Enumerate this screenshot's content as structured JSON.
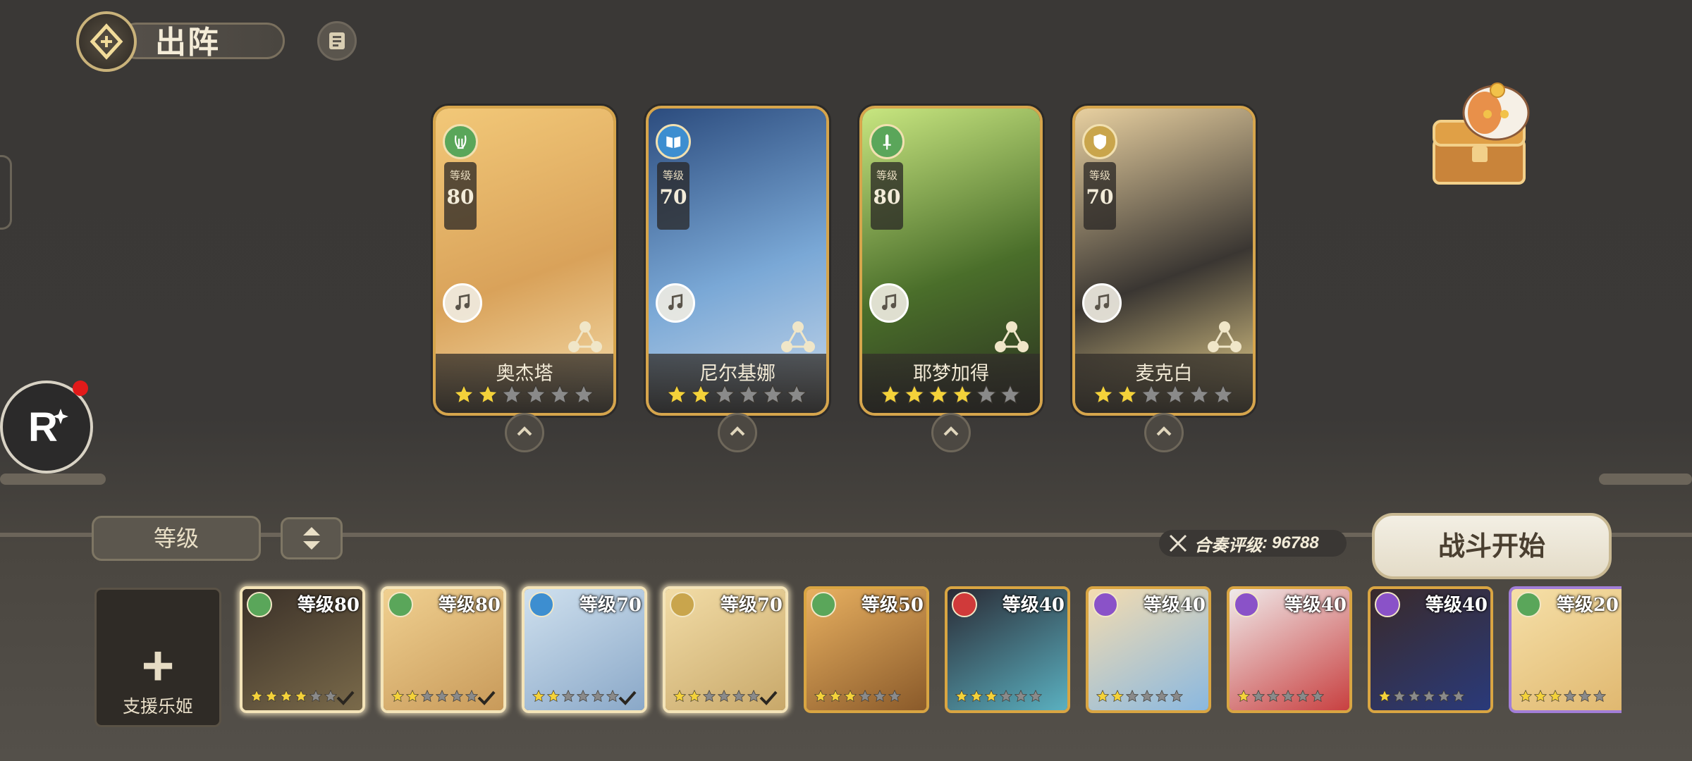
{
  "header": {
    "title": "出阵"
  },
  "team": [
    {
      "name": "奥杰塔",
      "level_label": "等级",
      "level": "80",
      "class_icon": "lyre-icon",
      "class_color": "#5aa65a",
      "stars": 2,
      "total_stars": 6,
      "art_colors": [
        "#f2c878",
        "#d9a25a",
        "#f6e0b0"
      ]
    },
    {
      "name": "尼尔基娜",
      "level_label": "等级",
      "level": "70",
      "class_icon": "book-icon",
      "class_color": "#3d8ed0",
      "stars": 2,
      "total_stars": 6,
      "art_colors": [
        "#2c4c7e",
        "#7aa8d6",
        "#c8d8ea"
      ]
    },
    {
      "name": "耶梦加得",
      "level_label": "等级",
      "level": "80",
      "class_icon": "sword-icon",
      "class_color": "#5aa65a",
      "stars": 4,
      "total_stars": 6,
      "art_colors": [
        "#c8e680",
        "#4a6e2a",
        "#2a3020"
      ]
    },
    {
      "name": "麦克白",
      "level_label": "等级",
      "level": "70",
      "class_icon": "shield-icon",
      "class_color": "#c9a54c",
      "stars": 2,
      "total_stars": 6,
      "art_colors": [
        "#e8d0a0",
        "#3a3632",
        "#f0d890"
      ]
    }
  ],
  "controls": {
    "sort_label": "等级",
    "power_label": "合奏评级",
    "power_value": "96788",
    "start_label": "战斗开始",
    "support_label": "支援乐姬"
  },
  "roster": [
    {
      "level": "等级80",
      "class_icon": "sword-icon",
      "class_color": "#5aa65a",
      "stars": 4,
      "selected": true,
      "art": [
        "#3a3028",
        "#7a6a4a"
      ]
    },
    {
      "level": "等级80",
      "class_icon": "lyre-icon",
      "class_color": "#5aa65a",
      "stars": 2,
      "selected": true,
      "art": [
        "#f0d090",
        "#c89a5a"
      ]
    },
    {
      "level": "等级70",
      "class_icon": "book-icon",
      "class_color": "#3d8ed0",
      "stars": 2,
      "selected": true,
      "art": [
        "#cfe0ee",
        "#8aa8c8"
      ]
    },
    {
      "level": "等级70",
      "class_icon": "shield-icon",
      "class_color": "#c9a54c",
      "stars": 2,
      "selected": true,
      "art": [
        "#f2dca6",
        "#c8a86a"
      ]
    },
    {
      "level": "等级50",
      "class_icon": "sword-icon",
      "class_color": "#5aa65a",
      "stars": 3,
      "selected": false,
      "art": [
        "#e8b060",
        "#8a5a2a"
      ]
    },
    {
      "level": "等级40",
      "class_icon": "book-icon",
      "class_color": "#d03a3a",
      "stars": 3,
      "selected": false,
      "art": [
        "#2a2a34",
        "#5ab0c0"
      ]
    },
    {
      "level": "等级40",
      "class_icon": "lyre-icon",
      "class_color": "#8a52c8",
      "stars": 2,
      "selected": false,
      "art": [
        "#f4dcb0",
        "#8ab8e0"
      ]
    },
    {
      "level": "等级40",
      "class_icon": "lyre-icon",
      "class_color": "#8a52c8",
      "stars": 1,
      "selected": false,
      "art": [
        "#f0eaea",
        "#c84040"
      ]
    },
    {
      "level": "等级40",
      "class_icon": "shield-icon",
      "class_color": "#8a52c8",
      "stars": 1,
      "selected": false,
      "art": [
        "#3a2a2a",
        "#2a3a7a"
      ]
    },
    {
      "level": "等级20",
      "class_icon": "lyre-icon",
      "class_color": "#5aa65a",
      "stars": 3,
      "selected": false,
      "art": [
        "#f6e0a8",
        "#e0b870"
      ],
      "purple": true
    }
  ]
}
